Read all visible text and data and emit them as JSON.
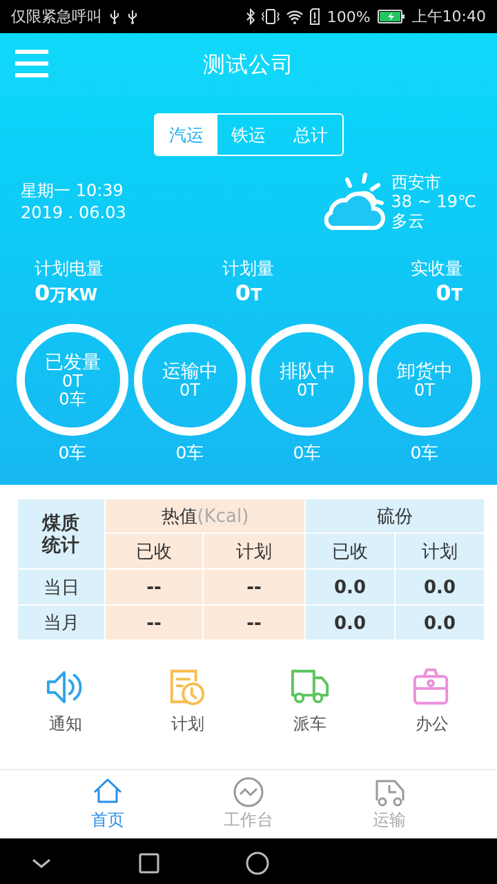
{
  "status_bar": {
    "notice": "仅限紧急呼叫",
    "battery": "100%",
    "time": "上午10:40"
  },
  "header": {
    "title": "测试公司"
  },
  "tabs": [
    {
      "label": "汽运",
      "selected": true
    },
    {
      "label": "铁运",
      "selected": false
    },
    {
      "label": "总计",
      "selected": false
    }
  ],
  "date": {
    "weekday_time": "星期一 10:39",
    "date": "2019 . 06.03"
  },
  "weather": {
    "city": "西安市",
    "temperature": "38 ~ 19℃",
    "condition": "多云"
  },
  "stats": [
    {
      "label": "计划电量",
      "value": "0",
      "unit": "万KW"
    },
    {
      "label": "计划量",
      "value": "0",
      "unit": "T"
    },
    {
      "label": "实收量",
      "value": "0",
      "unit": "T"
    }
  ],
  "stages": [
    {
      "label": "已发量",
      "lines": [
        "0T",
        "0车"
      ],
      "count": "0车"
    },
    {
      "label": "运输中",
      "lines": [
        "0T"
      ],
      "count": "0车"
    },
    {
      "label": "排队中",
      "lines": [
        "0T"
      ],
      "count": "0车"
    },
    {
      "label": "卸货中",
      "lines": [
        "0T"
      ],
      "count": "0车"
    }
  ],
  "quality_table": {
    "corner": "煤质统计",
    "groups": [
      {
        "label": "热值",
        "unit": "(Kcal)",
        "color": "#fde9da"
      },
      {
        "label": "硫份",
        "color": "#daf0fb"
      }
    ],
    "columns": [
      "已收",
      "计划",
      "已收",
      "计划"
    ],
    "rows": [
      {
        "label": "当日",
        "cells": [
          "--",
          "--",
          "0.0",
          "0.0"
        ]
      },
      {
        "label": "当月",
        "cells": [
          "--",
          "--",
          "0.0",
          "0.0"
        ]
      }
    ]
  },
  "shortcuts": [
    {
      "label": "通知",
      "kind": "speaker",
      "color": "#2fa5ec"
    },
    {
      "label": "计划",
      "kind": "schedule",
      "color": "#f8bd4e"
    },
    {
      "label": "派车",
      "kind": "truck",
      "color": "#5cc45f"
    },
    {
      "label": "办公",
      "kind": "bag",
      "color": "#ec8fdc"
    }
  ],
  "bottom_nav": [
    {
      "label": "首页",
      "kind": "home",
      "selected": true
    },
    {
      "label": "工作台",
      "kind": "pulse",
      "selected": false
    },
    {
      "label": "运输",
      "kind": "delivery",
      "selected": false
    }
  ]
}
